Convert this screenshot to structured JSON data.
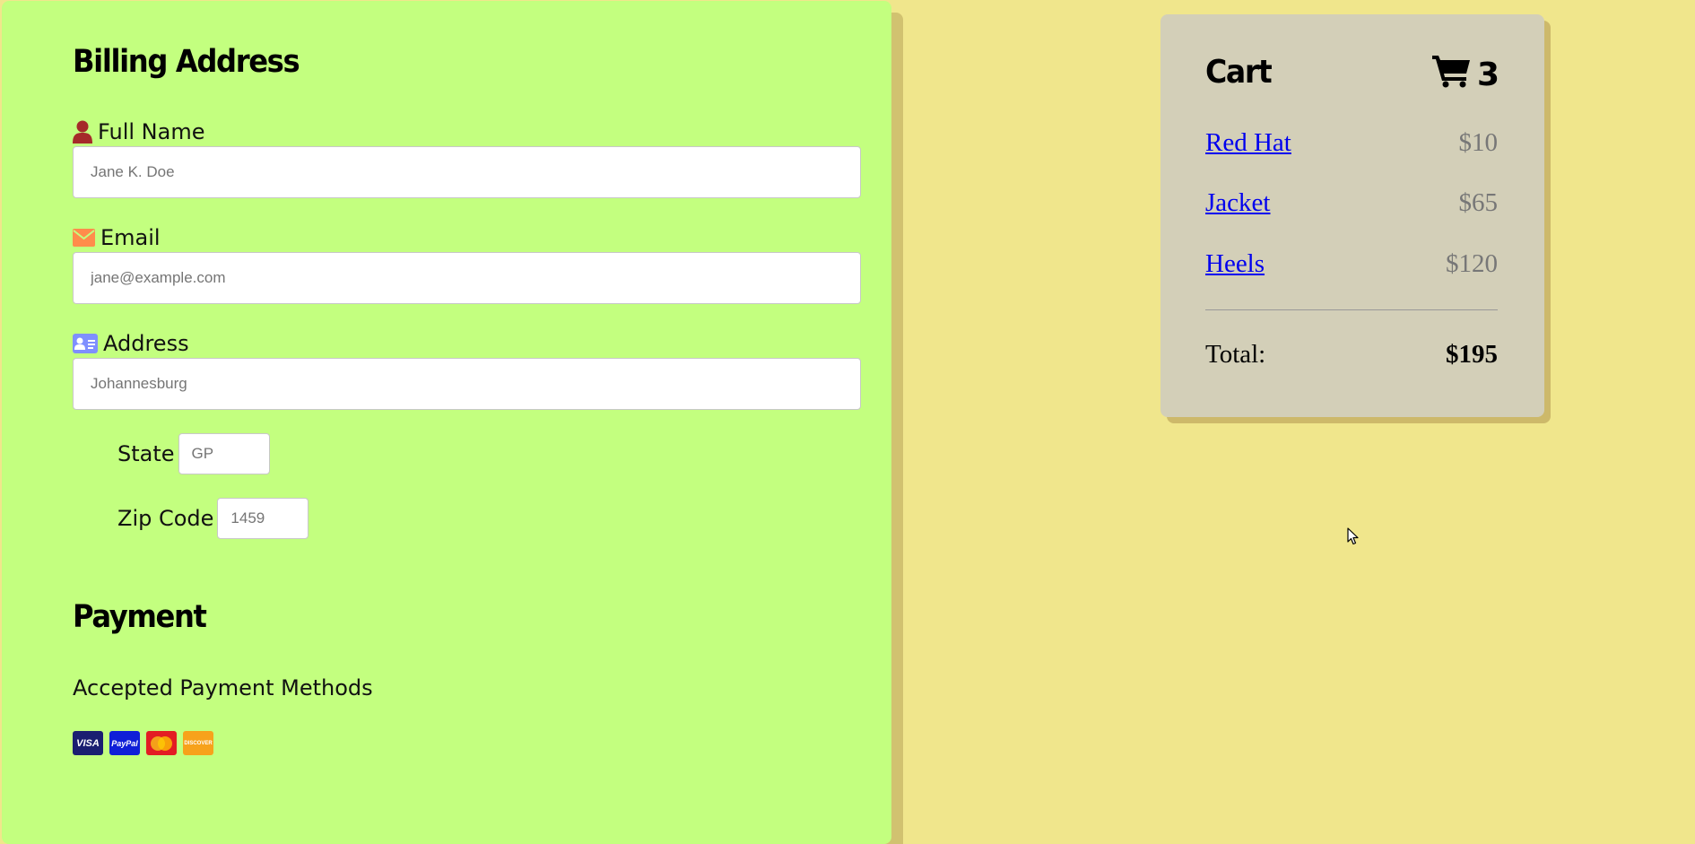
{
  "billing": {
    "title": "Billing Address",
    "full_name_label": "Full Name",
    "full_name_placeholder": "Jane K. Doe",
    "email_label": "Email",
    "email_placeholder": "jane@example.com",
    "address_label": "Address",
    "address_placeholder": "Johannesburg",
    "state_label": "State",
    "state_placeholder": "GP",
    "zip_label": "Zip Code",
    "zip_placeholder": "1459"
  },
  "payment": {
    "title": "Payment",
    "accepted_label": "Accepted Payment Methods",
    "methods": [
      {
        "name": "VISA",
        "icon": "visa-icon",
        "color": "#1a1f71"
      },
      {
        "name": "PayPal",
        "icon": "paypal-icon",
        "color": "#0f1fd8"
      },
      {
        "name": "",
        "icon": "mastercard-icon",
        "color": "#e31c23"
      },
      {
        "name": "DISCOVER",
        "icon": "discover-icon",
        "color": "#f7a21b"
      }
    ]
  },
  "cart": {
    "title": "Cart",
    "count": "3",
    "icon": "shopping-cart-icon",
    "items": [
      {
        "name": "Red Hat",
        "price": "$10"
      },
      {
        "name": "Jacket",
        "price": "$65"
      },
      {
        "name": "Heels",
        "price": "$120"
      }
    ],
    "total_label": "Total:",
    "total_value": "$195"
  },
  "colors": {
    "page_background": "#f0e68c",
    "form_background": "#c3ff7f",
    "cart_background": "#d3cfb8",
    "link": "#0000ee",
    "name_icon": "#a52a2a",
    "email_icon": "#ff8c4b",
    "address_icon": "#7f8fff"
  }
}
